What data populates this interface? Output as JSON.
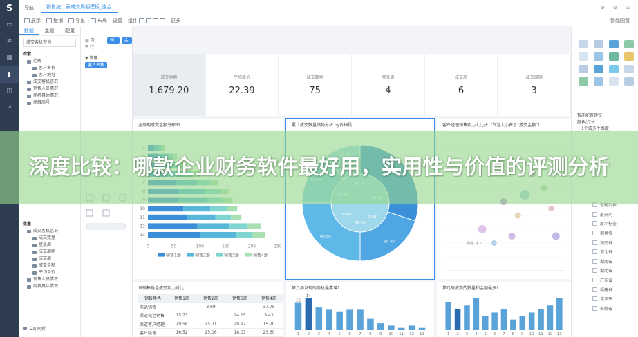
{
  "app": {
    "logo": "S",
    "home": "导航",
    "tab_title": "销售统计表成交周期模板_这会"
  },
  "topbar_right": [
    "⚙",
    "⚙",
    "⊡"
  ],
  "toolbar": {
    "items": [
      "展示",
      "撤销",
      "导出",
      "布局",
      "设置",
      "组件",
      "更多"
    ],
    "right_label": "智能配置"
  },
  "data_panel": {
    "tabs": [
      "数据",
      "主题",
      "配置"
    ],
    "dataset": "成交客机查询",
    "search": "检索",
    "tree_top": [
      {
        "level": 1,
        "label": "范畴"
      },
      {
        "level": 2,
        "label": "客户名称"
      },
      {
        "level": 2,
        "label": "客户地址"
      },
      {
        "level": 1,
        "label": "成交客机信况"
      },
      {
        "level": 1,
        "label": "销售人员情况"
      },
      {
        "level": 1,
        "label": "商机具体情况"
      },
      {
        "level": 1,
        "label": "商级库号"
      }
    ],
    "tree_bottom_header": "数量",
    "tree_bottom": [
      {
        "level": 1,
        "label": "成交客机信况"
      },
      {
        "level": 2,
        "label": "成交数量"
      },
      {
        "level": 2,
        "label": "登录周"
      },
      {
        "level": 2,
        "label": "成交周期"
      },
      {
        "level": 2,
        "label": "成交周"
      },
      {
        "level": 2,
        "label": "成交金额"
      },
      {
        "level": 2,
        "label": "平均单价"
      },
      {
        "level": 1,
        "label": "销售人员情况"
      },
      {
        "level": 1,
        "label": "商机具体情况"
      }
    ],
    "footer": "立即刷新"
  },
  "field_panel": {
    "row1": "列",
    "row2": "行",
    "chip1": "销售小组",
    "chip2": "金额区",
    "filter": "筛选",
    "filter_chip": "客户名称"
  },
  "kpis": [
    {
      "label": "成交金额",
      "value": "1,679.20"
    },
    {
      "label": "平均单价",
      "value": "22.39"
    },
    {
      "label": "成交数量",
      "value": "75"
    },
    {
      "label": "登录周",
      "value": "4"
    },
    {
      "label": "成交周",
      "value": "6"
    },
    {
      "label": "成交周期",
      "value": "3"
    }
  ],
  "cards": {
    "hbar_title": "全周期成交金额分布图",
    "pie_title": "累计成交数量结构分析 by价格段",
    "scatter_title": "客户经理销售实力大比拼（气泡大小表示“成交金额”）",
    "table_title": "当销售角色成交实力对比",
    "col1_title": "第几周发现的商机最靠谱?",
    "col2_title": "第几周成交的数量和金额最多?"
  },
  "table": {
    "header": [
      "销售角色",
      "销售1部",
      "销售2部",
      "销售3部",
      "销售4部"
    ],
    "rows": [
      [
        "电话销售",
        "",
        "3.69",
        "",
        "37.75"
      ],
      [
        "渠道电话销售",
        "15.73",
        "",
        "24.15",
        "8.43"
      ],
      [
        "渠道客户经理",
        "29.58",
        "25.71",
        "29.97",
        "15.70"
      ],
      [
        "客户经理",
        "16.52",
        "25.06",
        "18.03",
        "23.60"
      ]
    ]
  },
  "props_panel": {
    "section1": "智能配置建议",
    "section2": "颜色/尺寸",
    "section2_sub": "1个或多个维度",
    "list": [
      "智能列表",
      "展开列",
      "展示标签",
      "测量值",
      "河南省",
      "河北省",
      "湖南省",
      "湖北省",
      "广东省",
      "福建省",
      "北京市",
      "安徽省"
    ]
  },
  "banner": {
    "title": "深度比较：哪款企业财务软件最好用，实用性与价值的评测分析"
  },
  "chart_data": [
    {
      "type": "bar",
      "orientation": "horizontal",
      "title": "全周期成交金额分布图",
      "categories": [
        "1",
        "3",
        "5",
        "6",
        "7",
        "8",
        "9",
        "10",
        "11",
        "12",
        "13"
      ],
      "series": [
        {
          "name": "销售1部",
          "values": [
            12,
            20,
            25,
            35,
            55,
            60,
            58,
            68,
            75,
            95,
            100
          ]
        },
        {
          "name": "销售2部",
          "values": [
            10,
            18,
            20,
            30,
            40,
            50,
            55,
            52,
            55,
            62,
            70
          ]
        },
        {
          "name": "销售3部",
          "values": [
            6,
            10,
            15,
            20,
            25,
            30,
            30,
            32,
            30,
            35,
            30
          ]
        },
        {
          "name": "销售4部",
          "values": [
            5,
            8,
            10,
            15,
            15,
            15,
            20,
            20,
            20,
            25,
            25
          ]
        }
      ],
      "xlim": [
        0,
        250
      ],
      "xticks": [
        "0",
        "50",
        "100",
        "150",
        "200",
        "250"
      ],
      "legend_position": "bottom"
    },
    {
      "type": "pie",
      "style": "sunburst",
      "title": "累计成交数量结构分析 by价格段",
      "segments": [
        {
          "label": "≤30",
          "value": 30,
          "color": "#3b8fd9"
        },
        {
          "label": "30-40",
          "value": 20,
          "color": "#4fa6e3"
        },
        {
          "label": "40-50",
          "value": 25,
          "color": "#5eb8e8"
        },
        {
          "label": "50-60",
          "value": 15,
          "color": "#7cc8ea"
        },
        {
          "label": "60-70",
          "value": 10,
          "color": "#9ed8ee"
        }
      ],
      "labels": [
        "30-40",
        "30-40",
        "40-50",
        "30-40",
        "40-50",
        "50-60"
      ]
    },
    {
      "type": "scatter",
      "title": "客户经理销售实力大比拼（气泡大小表示“成交金额”）",
      "points": [
        {
          "x": 30,
          "y": 30,
          "size": 10,
          "color": "#d8b8e6"
        },
        {
          "x": 48,
          "y": 50,
          "size": 8,
          "color": "#b88ad6"
        },
        {
          "x": 60,
          "y": 40,
          "size": 7,
          "color": "#e4d0a8"
        },
        {
          "x": 66,
          "y": 55,
          "size": 12,
          "color": "#9cc6e8"
        },
        {
          "x": 72,
          "y": 70,
          "size": 9,
          "color": "#c9a0dc"
        },
        {
          "x": 82,
          "y": 60,
          "size": 7,
          "color": "#b0d6a8"
        },
        {
          "x": 88,
          "y": 45,
          "size": 6,
          "color": "#e0b8b8"
        },
        {
          "x": 40,
          "y": 20,
          "size": 6,
          "color": "#a8c8e8"
        },
        {
          "x": 55,
          "y": 25,
          "size": 8,
          "color": "#c8b0e0"
        },
        {
          "x": 92,
          "y": 25,
          "size": 9,
          "color": "#b8b0e4"
        }
      ],
      "xlim": [
        0,
        100
      ],
      "ylim": [
        0,
        100
      ],
      "annotation": "张东 化工"
    },
    {
      "type": "bar",
      "title": "第几周发现的商机最靠谱?",
      "categories": [
        "1",
        "2",
        "3",
        "4",
        "5",
        "6",
        "7",
        "8",
        "9",
        "10",
        "11",
        "12",
        "13"
      ],
      "values": [
        12,
        14,
        10,
        9,
        8,
        9,
        9,
        5,
        3,
        2,
        1,
        2,
        1
      ],
      "data_labels": [
        "12",
        "14",
        "",
        "",
        "",
        "",
        "",
        "",
        "",
        "",
        "",
        "",
        ""
      ],
      "color": "#5aa3d8",
      "highlight_color": "#2b6cb0"
    },
    {
      "type": "bar",
      "title": "第几周成交的数量和金额最多?",
      "categories": [
        "1",
        "2",
        "3",
        "4",
        "5",
        "6",
        "7",
        "8",
        "9",
        "10",
        "11",
        "12",
        "13"
      ],
      "values": [
        8,
        6,
        7,
        9,
        4,
        5,
        6,
        3,
        4,
        5,
        6,
        7,
        9
      ],
      "color": "#5aa3d8",
      "highlight_color": "#2b6cb0"
    }
  ]
}
